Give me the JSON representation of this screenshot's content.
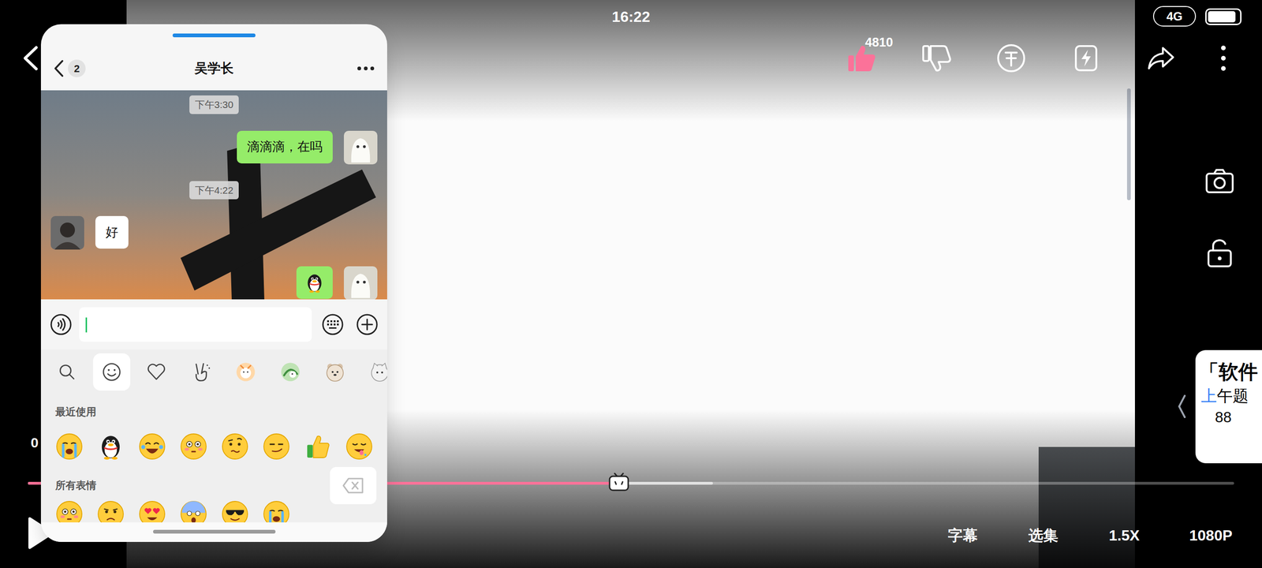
{
  "status_bar": {
    "time": "16:22",
    "network": "4G",
    "battery": 0.9
  },
  "player": {
    "likes": "4810",
    "liked": true,
    "elapsed": "0",
    "progress": {
      "played": 0.49,
      "buffered": 0.568
    },
    "controls": [
      {
        "label": "字幕"
      },
      {
        "label": "选集"
      },
      {
        "label": "1.5X"
      },
      {
        "label": "1080P"
      }
    ]
  },
  "side_card": {
    "title": "「软件",
    "subtitle": [
      {
        "text": "上",
        "highlight": true
      },
      {
        "text": "午题",
        "highlight": false
      }
    ],
    "count": "88"
  },
  "chat": {
    "title": "吴学长",
    "unread": "2",
    "messages": [
      {
        "kind": "time",
        "text": "下午3:30"
      },
      {
        "kind": "text",
        "from": "me",
        "text": "滴滴滴，在吗"
      },
      {
        "kind": "time",
        "text": "下午4:22"
      },
      {
        "kind": "text",
        "from": "other",
        "text": "好"
      },
      {
        "kind": "sticker",
        "from": "me"
      }
    ],
    "input": {
      "value": "",
      "focused": true
    },
    "emoji_tabs": [
      {
        "kind": "search",
        "selected": false
      },
      {
        "kind": "smile",
        "selected": true
      },
      {
        "kind": "heart",
        "selected": false
      },
      {
        "kind": "gesture",
        "selected": false
      },
      {
        "kind": "sticker-orange",
        "selected": false
      },
      {
        "kind": "sticker-green",
        "selected": false
      },
      {
        "kind": "sticker-bear",
        "selected": false
      },
      {
        "kind": "sticker-cat",
        "selected": false
      }
    ],
    "sections": [
      {
        "label": "最近使用",
        "emojis": [
          {
            "kind": "cry"
          },
          {
            "kind": "penguin"
          },
          {
            "kind": "laugh-cry"
          },
          {
            "kind": "flushed"
          },
          {
            "kind": "doubt"
          },
          {
            "kind": "smirk"
          },
          {
            "kind": "thumbs-up"
          },
          {
            "kind": "drool"
          }
        ]
      },
      {
        "label": "所有表情",
        "emojis": [
          {
            "kind": "flushed"
          },
          {
            "kind": "worried"
          },
          {
            "kind": "heart-eyes"
          },
          {
            "kind": "scared"
          },
          {
            "kind": "cool"
          },
          {
            "kind": "cry"
          }
        ]
      }
    ]
  }
}
